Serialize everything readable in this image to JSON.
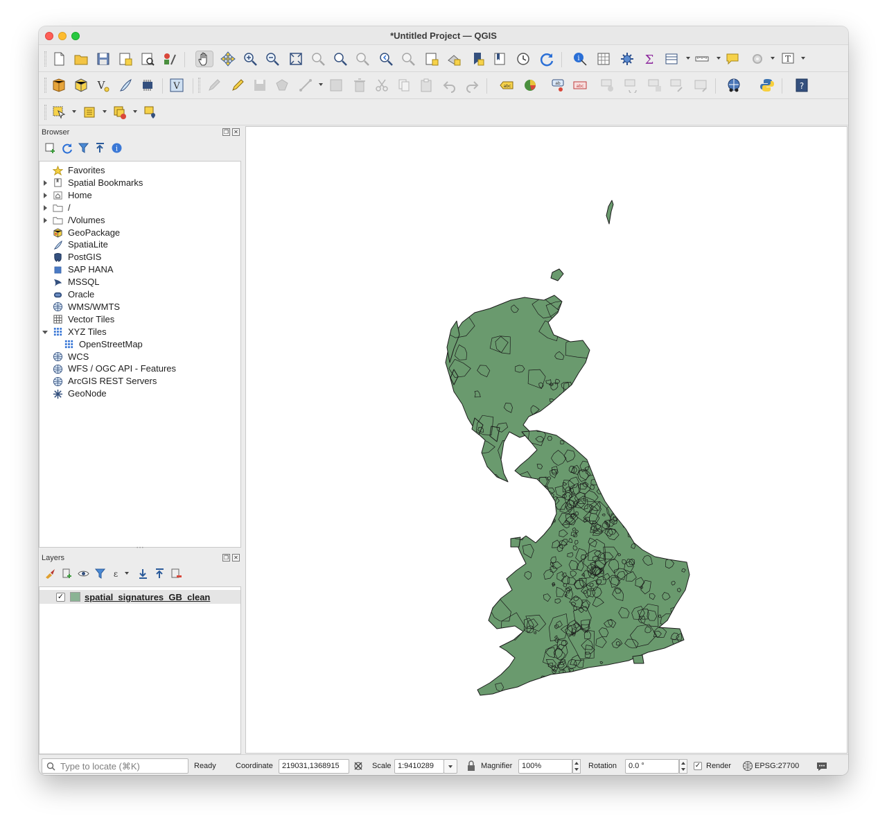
{
  "window": {
    "title": "*Untitled Project — QGIS"
  },
  "browser": {
    "title": "Browser",
    "items": [
      {
        "label": "Favorites",
        "icon": "star-icon",
        "expand": "none",
        "indent": 0
      },
      {
        "label": "Spatial Bookmarks",
        "icon": "bookmarks-icon",
        "expand": "closed",
        "indent": 0
      },
      {
        "label": "Home",
        "icon": "home-folder-icon",
        "expand": "closed",
        "indent": 0
      },
      {
        "label": "/",
        "icon": "folder-icon",
        "expand": "closed",
        "indent": 0
      },
      {
        "label": "/Volumes",
        "icon": "folder-icon",
        "expand": "closed",
        "indent": 0
      },
      {
        "label": "GeoPackage",
        "icon": "geopackage-icon",
        "expand": "none",
        "indent": 0
      },
      {
        "label": "SpatiaLite",
        "icon": "spatialite-icon",
        "expand": "none",
        "indent": 0
      },
      {
        "label": "PostGIS",
        "icon": "postgis-icon",
        "expand": "none",
        "indent": 0
      },
      {
        "label": "SAP HANA",
        "icon": "sap-hana-icon",
        "expand": "none",
        "indent": 0
      },
      {
        "label": "MSSQL",
        "icon": "mssql-icon",
        "expand": "none",
        "indent": 0
      },
      {
        "label": "Oracle",
        "icon": "oracle-icon",
        "expand": "none",
        "indent": 0
      },
      {
        "label": "WMS/WMTS",
        "icon": "globe-icon",
        "expand": "none",
        "indent": 0
      },
      {
        "label": "Vector Tiles",
        "icon": "vector-tiles-icon",
        "expand": "none",
        "indent": 0
      },
      {
        "label": "XYZ Tiles",
        "icon": "xyz-tiles-icon",
        "expand": "open",
        "indent": 0
      },
      {
        "label": "OpenStreetMap",
        "icon": "xyz-tiles-icon",
        "expand": "none",
        "indent": 1
      },
      {
        "label": "WCS",
        "icon": "globe-icon",
        "expand": "none",
        "indent": 0
      },
      {
        "label": "WFS / OGC API - Features",
        "icon": "globe-icon",
        "expand": "none",
        "indent": 0
      },
      {
        "label": "ArcGIS REST Servers",
        "icon": "globe-icon",
        "expand": "none",
        "indent": 0
      },
      {
        "label": "GeoNode",
        "icon": "geonode-icon",
        "expand": "none",
        "indent": 0
      }
    ]
  },
  "layers": {
    "title": "Layers",
    "items": [
      {
        "name": "spatial_signatures_GB_clean",
        "checked": "✓",
        "color": "#8ab394"
      }
    ]
  },
  "map": {
    "fill_color": "#6a9a6e",
    "stroke_color": "#1a1a1a"
  },
  "status": {
    "locate_placeholder": "Type to locate (⌘K)",
    "state": "Ready",
    "coordinate_label": "Coordinate",
    "coordinate_value": "219031,1368915",
    "scale_label": "Scale",
    "scale_value": "1:9410289",
    "magnifier_label": "Magnifier",
    "magnifier_value": "100%",
    "rotation_label": "Rotation",
    "rotation_value": "0.0 °",
    "render_label": "Render",
    "render_checked": "✓",
    "crs": "EPSG:27700"
  }
}
